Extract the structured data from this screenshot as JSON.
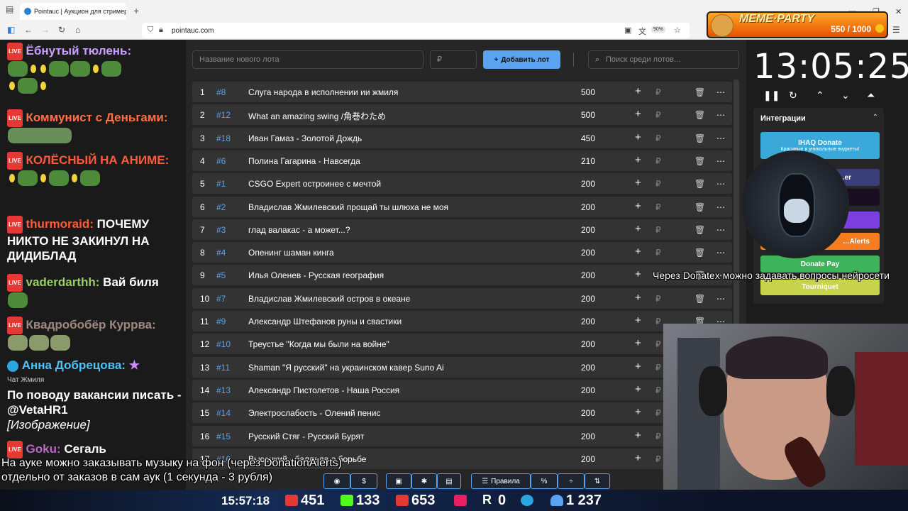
{
  "browser": {
    "tab_title": "Pointauc | Аукцион для стримеров",
    "url": "pointauc.com",
    "zoom": "90%"
  },
  "meme_party": {
    "title": "MEME·PARTY",
    "score": "550 / 1000"
  },
  "chat": {
    "messages": [
      {
        "user": "Ёбнутый тюлень:",
        "color": "#c9a0ff",
        "text": ""
      },
      {
        "user": "Коммунист с Деньгами:",
        "color": "#ff7043",
        "text": ""
      },
      {
        "user": "КОЛЁСНЫЙ НА АНИМЕ:",
        "color": "#ff5a3c",
        "text": ""
      },
      {
        "user": "thurmoraid:",
        "color": "#ff5a3c",
        "text": "ПОЧЕМУ НИКТО НЕ ЗАКИНУЛ НА ДИДИБЛАД"
      },
      {
        "user": "vaderdarthh:",
        "color": "#9ccc65",
        "text": "Вай биля"
      },
      {
        "user": "Квадробобёр Куррва:",
        "color": "#a1887f",
        "text": ""
      },
      {
        "user": "Анна Добрецова:",
        "color": "#4fc3f7",
        "text": ""
      },
      {
        "user": "Goku:",
        "color": "#ba68c8",
        "text": "Сегаль"
      }
    ],
    "chat_label": "Чат Жмиля",
    "notice": "По поводу вакансии писать - @VetaHR1",
    "image_tag": "[Изображение]"
  },
  "auction": {
    "new_lot_placeholder": "Название нового лота",
    "amount_placeholder": "₽",
    "add_label": "Добавить лот",
    "search_placeholder": "Поиск среди лотов...",
    "lots": [
      {
        "n": "1",
        "id": "#8",
        "name": "Слуга народа в исполнении ии жмиля",
        "amount": "500"
      },
      {
        "n": "2",
        "id": "#12",
        "name": "What an amazing swing /角巻わため",
        "amount": "500"
      },
      {
        "n": "3",
        "id": "#18",
        "name": "Иван Гамаз - Золотой Дождь",
        "amount": "450"
      },
      {
        "n": "4",
        "id": "#6",
        "name": "Полина Гагарина - Навсегда",
        "amount": "210"
      },
      {
        "n": "5",
        "id": "#1",
        "name": "CSGO Expert остроинее с мечтой",
        "amount": "200"
      },
      {
        "n": "6",
        "id": "#2",
        "name": "Владислав Жмилевский прощай ты шлюха не моя",
        "amount": "200"
      },
      {
        "n": "7",
        "id": "#3",
        "name": "глад валакас - а может...?",
        "amount": "200"
      },
      {
        "n": "8",
        "id": "#4",
        "name": "Опенинг шаман кинга",
        "amount": "200"
      },
      {
        "n": "9",
        "id": "#5",
        "name": "Илья Оленев - Русская география",
        "amount": "200"
      },
      {
        "n": "10",
        "id": "#7",
        "name": "Владислав Жмилевский остров в океане",
        "amount": "200"
      },
      {
        "n": "11",
        "id": "#9",
        "name": "Александр Штефанов руны и свастики",
        "amount": "200"
      },
      {
        "n": "12",
        "id": "#10",
        "name": "Треустье \"Когда мы были на войне\"",
        "amount": "200"
      },
      {
        "n": "13",
        "id": "#11",
        "name": "Shaman \"Я русский\" на украинском кавер Suno Ai",
        "amount": "200"
      },
      {
        "n": "14",
        "id": "#13",
        "name": "Александр Пистолетов - Наша Россия",
        "amount": "200"
      },
      {
        "n": "15",
        "id": "#14",
        "name": "Электрослабость - Олений пенис",
        "amount": "200"
      },
      {
        "n": "16",
        "id": "#15",
        "name": "Русский Стяг - Русский Бурят",
        "amount": "200"
      },
      {
        "n": "17",
        "id": "#16",
        "name": "Высоцкий - баллада о борьбе",
        "amount": "200"
      }
    ],
    "currency": "₽"
  },
  "timer": {
    "value": "13:05:25"
  },
  "integrations": {
    "title": "Интеграции",
    "buttons": [
      {
        "label": "IHAQ Donate",
        "sub": "Красивые и уникальные виджеты!",
        "color": "#3aa8d8"
      },
      {
        "label": "…er",
        "color": "#3a3f7a"
      },
      {
        "label": "",
        "color": "#222"
      },
      {
        "label": "",
        "color": "#7b3fe0"
      },
      {
        "label": "…Alerts",
        "color": "#f57c20"
      },
      {
        "label": "Donate Pay",
        "color": "#3db35b"
      },
      {
        "label": "Tourniquet",
        "color": "#c7d34a"
      }
    ]
  },
  "overlay": {
    "donatex_text": "Через Donatex можно задавать вопросы нейросети",
    "music_line1": "На ауке можно заказывать музыку на фон (через DonationAlerts)",
    "music_line2": "отдельно от заказов в сам аук (1 секунда - 3 рубля)"
  },
  "toolbar": {
    "rules_label": "Правила",
    "percent_label": "%"
  },
  "status": {
    "time": "15:57:18",
    "youtube": "451",
    "kick": "133",
    "live": "653",
    "rutube": "0",
    "viewers": "1 237"
  },
  "colors": {
    "accent": "#5aa3f0",
    "row_bg": "#333333",
    "panel_bg": "#262626"
  }
}
